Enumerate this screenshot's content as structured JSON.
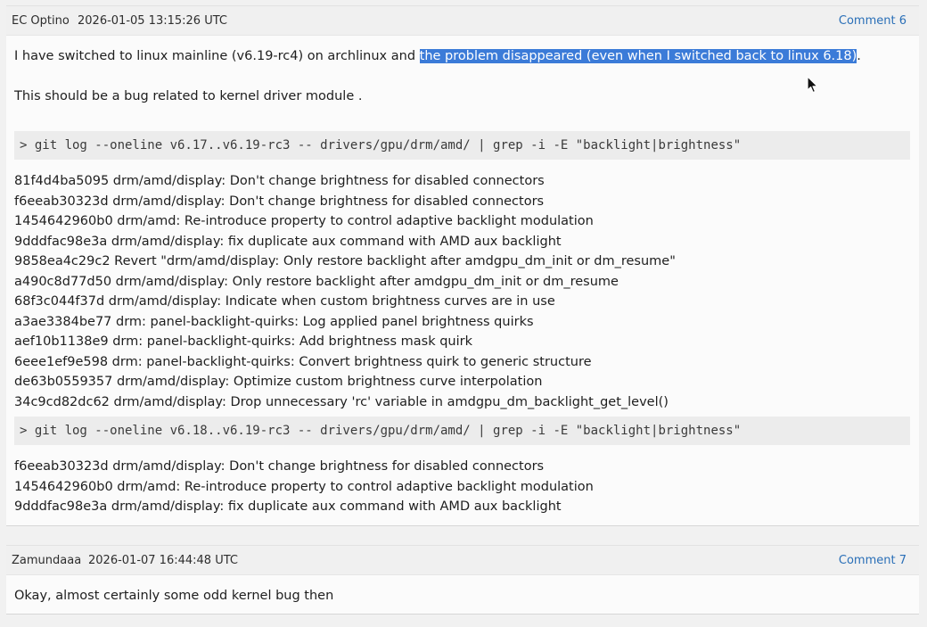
{
  "comments": [
    {
      "author": "EC Optino",
      "date": "2026-01-05 13:15:26 UTC",
      "link": "Comment 6",
      "para1_before": "I have switched to linux mainline (v6.19-rc4) on archlinux and ",
      "para1_highlight": "the problem disappeared (even when I switched back to linux 6.18)",
      "para1_after": ".",
      "para2": "This should be a bug related to kernel driver module .",
      "cmd1": "> git log --oneline v6.17..v6.19-rc3 -- drivers/gpu/drm/amd/ | grep -i -E \"backlight|brightness\"",
      "commits1": [
        "81f4d4ba5095 drm/amd/display: Don't change brightness for disabled connectors",
        "f6eeab30323d drm/amd/display: Don't change brightness for disabled connectors",
        "1454642960b0 drm/amd: Re-introduce property to control adaptive backlight modulation",
        "9dddfac98e3a drm/amd/display: fix duplicate aux command with AMD aux backlight",
        "9858ea4c29c2 Revert \"drm/amd/display: Only restore backlight after amdgpu_dm_init or dm_resume\"",
        "a490c8d77d50 drm/amd/display: Only restore backlight after amdgpu_dm_init or dm_resume",
        "68f3c044f37d drm/amd/display: Indicate when custom brightness curves are in use",
        "a3ae3384be77 drm: panel-backlight-quirks: Log applied panel brightness quirks",
        "aef10b1138e9 drm: panel-backlight-quirks: Add brightness mask quirk",
        "6eee1ef9e598 drm: panel-backlight-quirks: Convert brightness quirk to generic structure",
        "de63b0559357 drm/amd/display: Optimize custom brightness curve interpolation",
        "34c9cd82dc62 drm/amd/display: Drop unnecessary 'rc' variable in amdgpu_dm_backlight_get_level()"
      ],
      "cmd2": "> git log --oneline v6.18..v6.19-rc3 -- drivers/gpu/drm/amd/ | grep -i -E \"backlight|brightness\"",
      "commits2": [
        "f6eeab30323d drm/amd/display: Don't change brightness for disabled connectors",
        "1454642960b0 drm/amd: Re-introduce property to control adaptive backlight modulation",
        "9dddfac98e3a drm/amd/display: fix duplicate aux command with AMD aux backlight"
      ]
    },
    {
      "author": "Zamundaaa",
      "date": "2026-01-07 16:44:48 UTC",
      "link": "Comment 7",
      "text": "Okay, almost certainly some odd kernel bug then"
    }
  ],
  "colors": {
    "link": "#2a6fb7",
    "selection": "#3b7bd8"
  },
  "icons": {
    "cursor": "mouse-pointer-icon"
  }
}
